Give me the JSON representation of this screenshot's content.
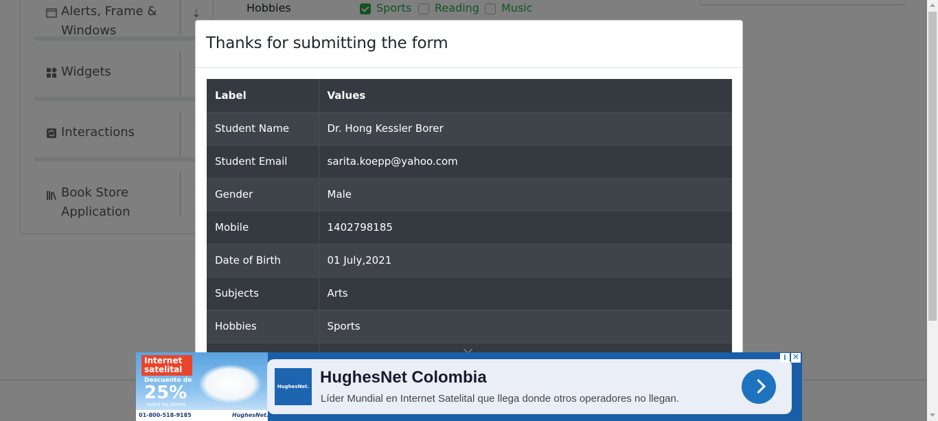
{
  "sidebar": {
    "groups": [
      {
        "title_line1": "Alerts, Frame &",
        "title_line2": "Windows",
        "icon": "window-icon"
      },
      {
        "title_line1": "Widgets",
        "title_line2": "",
        "icon": "widgets-icon"
      },
      {
        "title_line1": "Interactions",
        "title_line2": "",
        "icon": "interactions-icon"
      },
      {
        "title_line1": "Book Store",
        "title_line2": "Application",
        "icon": "book-icon"
      }
    ]
  },
  "form": {
    "hobbies_label": "Hobbies",
    "hobbies": [
      {
        "label": "Sports",
        "checked": true
      },
      {
        "label": "Reading",
        "checked": false
      },
      {
        "label": "Music",
        "checked": false
      }
    ]
  },
  "modal": {
    "title": "Thanks for submitting the form",
    "headers": {
      "label": "Label",
      "values": "Values"
    },
    "rows": [
      {
        "label": "Student Name",
        "value": "Dr. Hong Kessler Borer"
      },
      {
        "label": "Student Email",
        "value": "sarita.koepp@yahoo.com"
      },
      {
        "label": "Gender",
        "value": "Male"
      },
      {
        "label": "Mobile",
        "value": "1402798185"
      },
      {
        "label": "Date of Birth",
        "value": "01 July,2021"
      },
      {
        "label": "Subjects",
        "value": "Arts"
      },
      {
        "label": "Hobbies",
        "value": "Sports"
      }
    ]
  },
  "ad": {
    "promo_line1": "Internet",
    "promo_line2": "satelital",
    "promo_sub": "Descuento de",
    "promo_big": "25%",
    "promo_small": "todos los planes",
    "phone": "01-800-518-9185",
    "brand_small": "HughesNet.",
    "logo_text": "HughesNet.",
    "headline": "HughesNet Colombia",
    "description": "Líder Mundial en Internet Satelital que llega donde otros operadores no llegan.",
    "info": "i",
    "close": "✕"
  },
  "colors": {
    "accent_green": "#28a745",
    "table_dark": "#343a40",
    "ad_blue": "#1e73be"
  }
}
